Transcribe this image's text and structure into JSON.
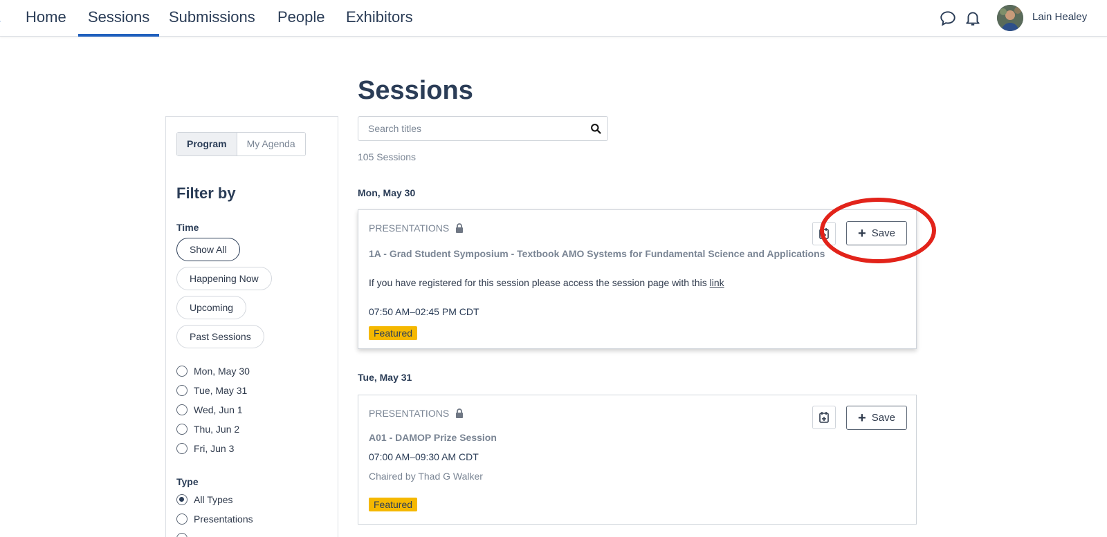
{
  "nav": {
    "items": [
      {
        "label": "Home"
      },
      {
        "label": "Sessions"
      },
      {
        "label": "Submissions"
      },
      {
        "label": "People"
      },
      {
        "label": "Exhibitors"
      }
    ],
    "active": "Sessions",
    "user_name": "Lain Healey",
    "icons": [
      "chat-bubble-icon",
      "bell-icon"
    ]
  },
  "sidebar": {
    "tabs": {
      "program": "Program",
      "my_agenda": "My Agenda"
    },
    "filter_title": "Filter by",
    "time_label": "Time",
    "time_options": [
      "Show All",
      "Happening Now",
      "Upcoming",
      "Past Sessions"
    ],
    "selected_time": "Show All",
    "days": [
      "Mon, May 30",
      "Tue, May 31",
      "Wed, Jun 1",
      "Thu, Jun 2",
      "Fri, Jun 3"
    ],
    "type_label": "Type",
    "types": [
      "All Types",
      "Presentations"
    ],
    "selected_type": "All Types"
  },
  "main": {
    "title": "Sessions",
    "search_placeholder": "Search titles",
    "count": "105 Sessions",
    "groups": [
      {
        "day": "Mon, May 30",
        "session": {
          "type": "PRESENTATIONS",
          "title": "1A - Grad Student Symposium - Textbook AMO Systems for Fundamental Science and Applications",
          "desc_prefix": "If you have registered for this session please access the session page with this ",
          "desc_link": "link",
          "time": "07:50 AM–02:45 PM CDT",
          "badge": "Featured",
          "save": "Save"
        }
      },
      {
        "day": "Tue, May 31",
        "session": {
          "type": "PRESENTATIONS",
          "title": "A01 - DAMOP Prize Session",
          "time": "07:00 AM–09:30 AM CDT",
          "chair": "Chaired by Thad G Walker",
          "badge": "Featured",
          "save": "Save"
        }
      }
    ]
  },
  "colors": {
    "accent": "#1f5fbd",
    "badge": "#f5b800",
    "annotation": "#e2231a",
    "text": "#2b3d57"
  }
}
